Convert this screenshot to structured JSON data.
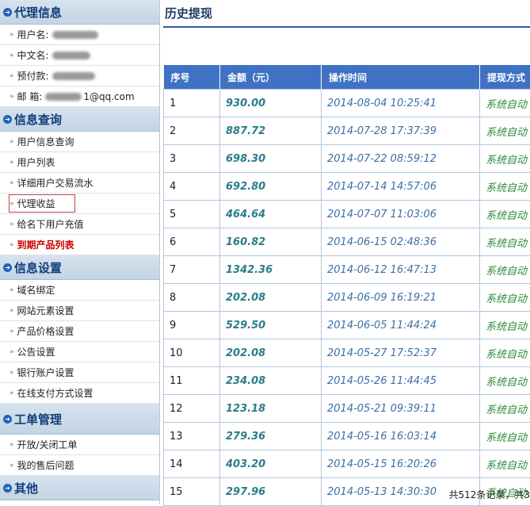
{
  "sidebar": {
    "agent_info": {
      "title": "代理信息",
      "username_label": "用户名:",
      "cnname_label": "中文名:",
      "prepay_label": "预付款:",
      "prepay_partial": "",
      "email_label": "邮 箱:",
      "email_partial": "1@qq.com"
    },
    "query": {
      "title": "信息查询",
      "items": [
        "用户信息查询",
        "用户列表",
        "详细用户交易流水",
        "代理收益",
        "给名下用户充值",
        "到期产品列表"
      ]
    },
    "settings": {
      "title": "信息设置",
      "items": [
        "域名绑定",
        "网站元素设置",
        "产品价格设置",
        "公告设置",
        "银行账户设置",
        "在线支付方式设置"
      ]
    },
    "tickets": {
      "title": "工单管理",
      "items": [
        "开放/关闭工单",
        "我的售后问题"
      ]
    },
    "other": {
      "title": "其他"
    }
  },
  "main": {
    "title": "历史提现",
    "columns": [
      "序号",
      "金额（元）",
      "操作时间",
      "提现方式"
    ],
    "rows": [
      {
        "no": "1",
        "amount": "930.00",
        "time": "2014-08-04 10:25:41",
        "mode": "系统自动"
      },
      {
        "no": "2",
        "amount": "887.72",
        "time": "2014-07-28 17:37:39",
        "mode": "系统自动"
      },
      {
        "no": "3",
        "amount": "698.30",
        "time": "2014-07-22 08:59:12",
        "mode": "系统自动"
      },
      {
        "no": "4",
        "amount": "692.80",
        "time": "2014-07-14 14:57:06",
        "mode": "系统自动"
      },
      {
        "no": "5",
        "amount": "464.64",
        "time": "2014-07-07 11:03:06",
        "mode": "系统自动"
      },
      {
        "no": "6",
        "amount": "160.82",
        "time": "2014-06-15 02:48:36",
        "mode": "系统自动"
      },
      {
        "no": "7",
        "amount": "1342.36",
        "time": "2014-06-12 16:47:13",
        "mode": "系统自动"
      },
      {
        "no": "8",
        "amount": "202.08",
        "time": "2014-06-09 16:19:21",
        "mode": "系统自动"
      },
      {
        "no": "9",
        "amount": "529.50",
        "time": "2014-06-05 11:44:24",
        "mode": "系统自动"
      },
      {
        "no": "10",
        "amount": "202.08",
        "time": "2014-05-27 17:52:37",
        "mode": "系统自动"
      },
      {
        "no": "11",
        "amount": "234.08",
        "time": "2014-05-26 11:44:45",
        "mode": "系统自动"
      },
      {
        "no": "12",
        "amount": "123.18",
        "time": "2014-05-21 09:39:11",
        "mode": "系统自动"
      },
      {
        "no": "13",
        "amount": "279.36",
        "time": "2014-05-16 16:03:14",
        "mode": "系统自动"
      },
      {
        "no": "14",
        "amount": "403.20",
        "time": "2014-05-15 16:20:26",
        "mode": "系统自动"
      },
      {
        "no": "15",
        "amount": "297.96",
        "time": "2014-05-13 14:30:30",
        "mode": "系统自动"
      }
    ],
    "pager": "共512条记录，共3"
  }
}
